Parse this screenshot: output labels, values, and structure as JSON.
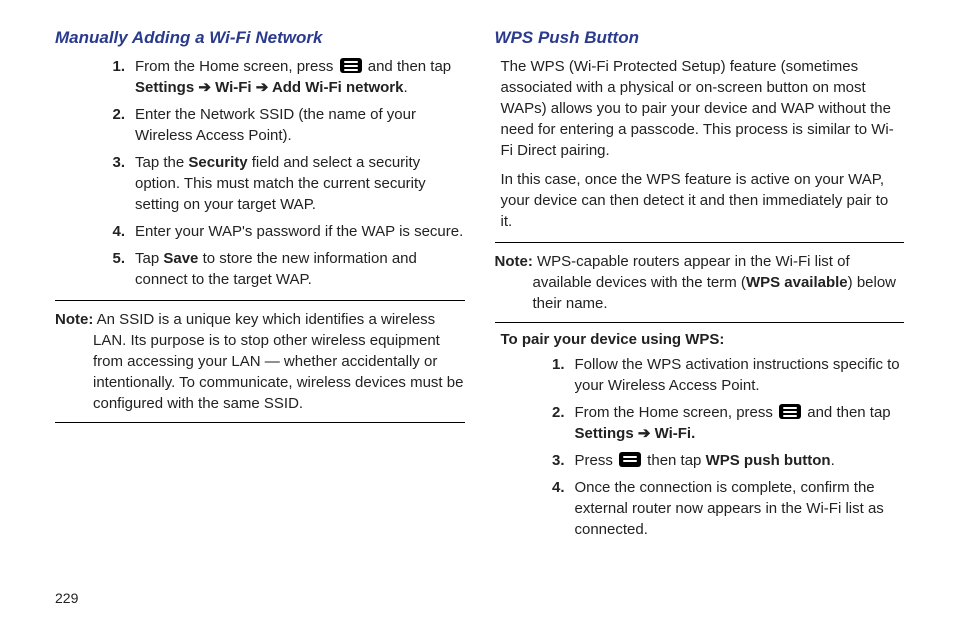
{
  "pageNumber": "229",
  "left": {
    "title": "Manually Adding a Wi-Fi Network",
    "steps": [
      {
        "num": "1.",
        "pre": "From the Home screen, press ",
        "post": " and then tap ",
        "bold1": "Settings ➔ Wi-Fi  ➔ Add Wi-Fi network",
        "tail": "."
      },
      {
        "num": "2.",
        "text": "Enter the Network SSID (the name of your Wireless Access Point)."
      },
      {
        "num": "3.",
        "pre": "Tap the ",
        "bold1": "Security",
        "post": " field and select a security option. This must match the current security setting on your target WAP."
      },
      {
        "num": "4.",
        "text": "Enter your WAP's password if the WAP is secure."
      },
      {
        "num": "5.",
        "pre": "Tap ",
        "bold1": "Save",
        "post": " to store the new information and connect to the target WAP."
      }
    ],
    "noteLabel": "Note:",
    "noteText": " An SSID is a unique key which identifies a wireless LAN. Its purpose is to stop other wireless equipment from accessing your LAN — whether accidentally or intentionally. To communicate, wireless devices must be configured with the same SSID."
  },
  "right": {
    "title": "WPS Push Button",
    "para1": "The WPS (Wi-Fi Protected Setup) feature (sometimes associated with a physical or on-screen button on most WAPs) allows you to pair your device and WAP without the need for entering a passcode. This process is similar to Wi-Fi Direct pairing.",
    "para2": "In this case, once the WPS feature is active on your WAP, your device can then detect it and then immediately pair to it.",
    "noteLabel": "Note:",
    "noteTextPre": " WPS-capable routers appear in the Wi-Fi list of available devices with the term (",
    "noteBold": "WPS available",
    "noteTextPost": ") below their name.",
    "lead": "To pair your device using WPS:",
    "steps": [
      {
        "num": "1.",
        "text": "Follow the WPS activation instructions specific to your Wireless Access Point."
      },
      {
        "num": "2.",
        "pre": "From the Home screen, press ",
        "post": " and then tap ",
        "bold1": "Settings ➔ Wi-Fi."
      },
      {
        "num": "3.",
        "pre": "Press ",
        "post": " then tap ",
        "bold1": "WPS push button",
        "tail": "."
      },
      {
        "num": "4.",
        "text": "Once the connection is complete, confirm the external router now appears in the Wi-Fi list as connected."
      }
    ]
  }
}
